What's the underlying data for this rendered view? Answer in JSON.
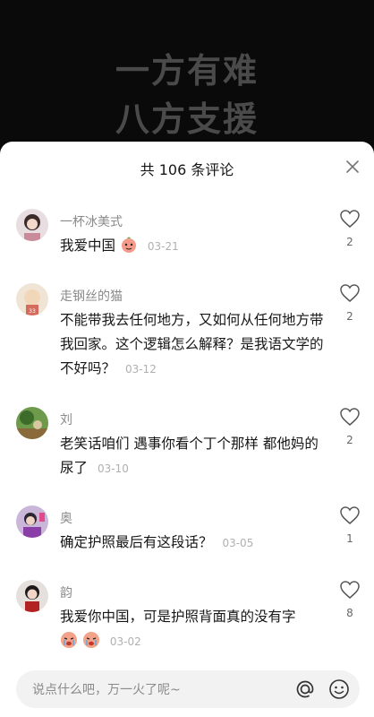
{
  "video": {
    "line1": "一方有难",
    "line2": "八方支援"
  },
  "header": {
    "title": "共 106 条评论"
  },
  "comments": [
    {
      "username": "一杯冰美式",
      "text": "我爱中国",
      "emoji": "peach-face",
      "date": "03-21",
      "likes": "2"
    },
    {
      "username": "走钢丝的猫",
      "text": "不能带我去任何地方，又如何从任何地方带我回家。这个逻辑怎么解释？是我语文学的不好吗？",
      "date": "03-12",
      "likes": "2"
    },
    {
      "username": "刘",
      "text": "老笑话咱们 遇事你看个丁个那样 都他妈的 尿了",
      "date": "03-10",
      "likes": "2"
    },
    {
      "username": "奥",
      "text": "确定护照最后有这段话？",
      "date": "03-05",
      "likes": "1"
    },
    {
      "username": "韵",
      "text": "我爱你中国，可是护照背面真的没有字",
      "emoji": "crying-face",
      "date": "03-02",
      "likes": "8"
    }
  ],
  "input": {
    "placeholder": "说点什么吧，万一火了呢~"
  },
  "colors": {
    "accent_text": "#161616",
    "muted_text": "#8a8a8a",
    "date_text": "#b0b0b0",
    "sheet_bg": "#ffffff"
  }
}
